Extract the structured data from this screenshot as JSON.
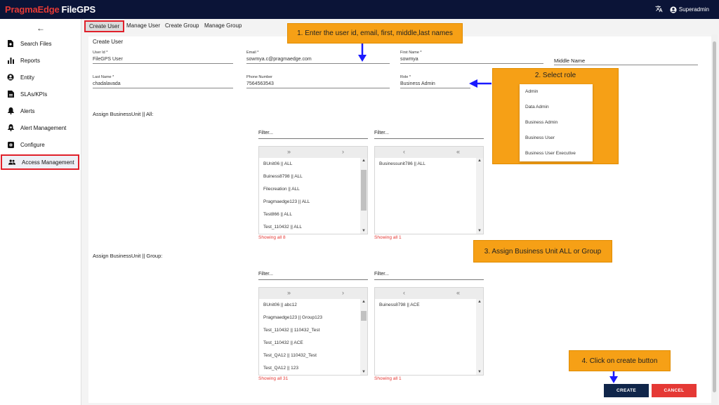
{
  "app": {
    "brand_part1": "PragmaEdge",
    "brand_part2": "FileGPS",
    "translate_icon": "translate-icon",
    "user_icon": "account-circle-icon",
    "user_name": "Superadmin"
  },
  "sidebar": {
    "back_icon": "arrow-left-icon",
    "items": [
      {
        "label": "Search Files",
        "icon": "file-search-icon"
      },
      {
        "label": "Reports",
        "icon": "bar-chart-icon"
      },
      {
        "label": "Entity",
        "icon": "account-circle-icon"
      },
      {
        "label": "SLAs/KPIs",
        "icon": "document-icon"
      },
      {
        "label": "Alerts",
        "icon": "bell-icon"
      },
      {
        "label": "Alert Management",
        "icon": "bell-gear-icon"
      },
      {
        "label": "Configure",
        "icon": "settings-box-icon"
      },
      {
        "label": "Access Management",
        "icon": "people-icon"
      }
    ],
    "active_index": 7
  },
  "tabs": [
    "Create User",
    "Manage User",
    "Create Group",
    "Manage Group"
  ],
  "form": {
    "title": "Create User",
    "user_id": {
      "label": "User Id *",
      "value": "FileGPS User"
    },
    "email": {
      "label": "Email *",
      "value": "sowmya.c@pragmaedge.com"
    },
    "first_name": {
      "label": "First Name *",
      "value": "sowmya"
    },
    "middle_name": {
      "placeholder": "Middle Name"
    },
    "last_name": {
      "label": "Last Name *",
      "value": "chadalavada"
    },
    "phone": {
      "label": "Phone Number",
      "value": "7564563543"
    },
    "role": {
      "label": "Role *",
      "value": "Business Admin"
    }
  },
  "assign_all": {
    "label": "Assign BusinessUnit || All:",
    "filter_left": "Filter...",
    "filter_right": "Filter...",
    "left_items": [
      "BUnit06 || ALL",
      "Buiness8798 || ALL",
      "Filecreation || ALL",
      "Pragmaedge123 || ALL",
      "Test866 || ALL",
      "Test_110432 || ALL"
    ],
    "right_items": [
      "Businessunit786 || ALL"
    ],
    "left_showing": "Showing all 8",
    "right_showing": "Showing all 1"
  },
  "assign_group": {
    "label": "Assign BusinessUnit || Group:",
    "filter_left": "Filter...",
    "filter_right": "Filter...",
    "left_items": [
      "BUnit06 || abc12",
      "Pragmaedge123 || Group123",
      "Test_110432 || 110432_Test",
      "Test_110432 || ACE",
      "Test_QA12 || 110432_Test",
      "Test_QA12 || 123"
    ],
    "right_items": [
      "Buiness8798 || ACE"
    ],
    "left_showing": "Showing all 31",
    "right_showing": "Showing all 1"
  },
  "list_controls": {
    "move_all_right": "»",
    "move_right": "›",
    "move_left": "‹",
    "move_all_left": "«"
  },
  "buttons": {
    "create": "CREATE",
    "cancel": "CANCEL"
  },
  "annotations": {
    "step1": "1. Enter the user id, email, first, middle,last names",
    "step2": "2. Select role",
    "step3": "3. Assign Business Unit ALL or Group",
    "step4": "4. Click on create button",
    "arrow_color": "#1a1aff"
  },
  "role_options": [
    "Admin",
    "Data Admin",
    "Business Admin",
    "Business User",
    "Business User Executive"
  ]
}
